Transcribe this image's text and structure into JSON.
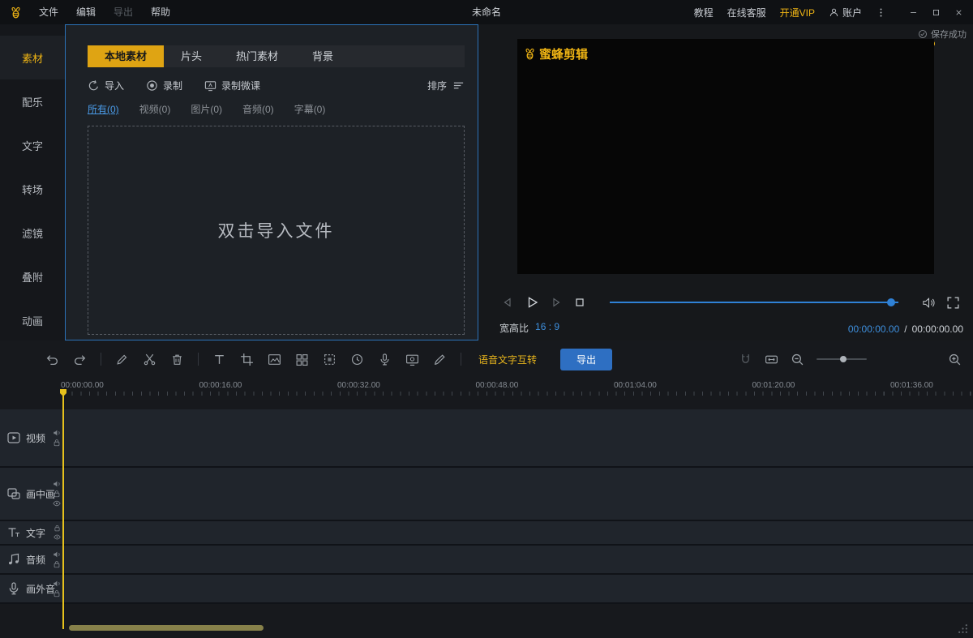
{
  "window": {
    "title": "未命名",
    "menus": [
      {
        "label": "文件",
        "enabled": true
      },
      {
        "label": "编辑",
        "enabled": true
      },
      {
        "label": "导出",
        "enabled": false
      },
      {
        "label": "帮助",
        "enabled": true
      }
    ],
    "links": {
      "tutorial": "教程",
      "support": "在线客服",
      "vip": "开通VIP",
      "account": "账户"
    }
  },
  "sidebar": {
    "items": [
      {
        "label": "素材",
        "active": true
      },
      {
        "label": "配乐",
        "active": false
      },
      {
        "label": "文字",
        "active": false
      },
      {
        "label": "转场",
        "active": false
      },
      {
        "label": "滤镜",
        "active": false
      },
      {
        "label": "叠附",
        "active": false
      },
      {
        "label": "动画",
        "active": false
      }
    ]
  },
  "media": {
    "tabs": [
      {
        "label": "本地素材",
        "active": true
      },
      {
        "label": "片头",
        "active": false
      },
      {
        "label": "热门素材",
        "active": false
      },
      {
        "label": "背景",
        "active": false
      }
    ],
    "actions": {
      "import": "导入",
      "record": "录制",
      "record_lesson": "录制微课",
      "sort": "排序"
    },
    "filters": [
      {
        "label": "所有(0)",
        "active": true
      },
      {
        "label": "视频(0)",
        "active": false
      },
      {
        "label": "图片(0)",
        "active": false
      },
      {
        "label": "音频(0)",
        "active": false
      },
      {
        "label": "字幕(0)",
        "active": false
      }
    ],
    "dropzone": "双击导入文件"
  },
  "preview": {
    "save_status": "保存成功",
    "watermark": "蜜蜂剪辑",
    "aspect_label": "宽高比",
    "aspect_value": "16 : 9",
    "time_current": "00:00:00.00",
    "time_divider": "/",
    "time_total": "00:00:00.00"
  },
  "timeline": {
    "tools": [
      "undo",
      "redo",
      "|",
      "edit",
      "split",
      "delete",
      "|",
      "text",
      "crop",
      "freeze-frame",
      "track-grid",
      "mosaic",
      "duration",
      "voice-record",
      "screen-record",
      "annotate"
    ],
    "voice_text_label": "语音文字互转",
    "export_label": "导出",
    "ruler": [
      "00:00:00.00",
      "00:00:16.00",
      "00:00:32.00",
      "00:00:48.00",
      "00:01:04.00",
      "00:01:20.00",
      "00:01:36.00"
    ],
    "tracks": [
      {
        "kind": "video",
        "label": "视频",
        "controls": [
          "mute",
          "lock"
        ]
      },
      {
        "kind": "pip",
        "label": "画中画",
        "controls": [
          "mute",
          "lock",
          "hide"
        ]
      },
      {
        "kind": "text",
        "label": "文字",
        "controls": [
          "lock",
          "hide"
        ]
      },
      {
        "kind": "audio",
        "label": "音频",
        "controls": [
          "mute",
          "lock"
        ]
      },
      {
        "kind": "voiceover",
        "label": "画外音",
        "controls": [
          "mute",
          "lock"
        ]
      }
    ]
  },
  "colors": {
    "gold": "#efb414",
    "blue": "#3e8fdd",
    "export_blue": "#2e6fc2"
  }
}
